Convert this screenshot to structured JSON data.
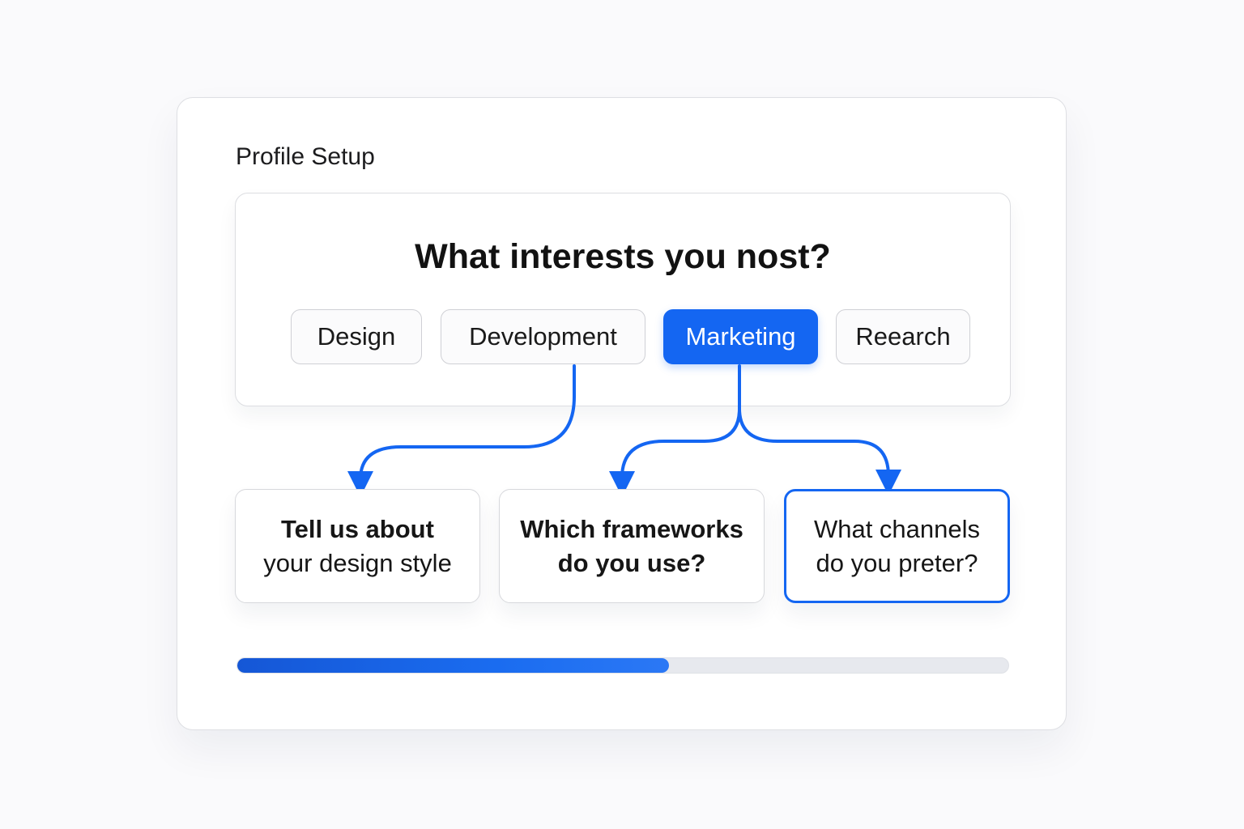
{
  "profile": {
    "title": "Profile Setup"
  },
  "question": {
    "title": "What interests you nost?",
    "options": [
      {
        "label": "Design",
        "selected": false
      },
      {
        "label": "Development",
        "selected": false
      },
      {
        "label": "Marketing",
        "selected": true
      },
      {
        "label": "Reearch",
        "selected": false
      }
    ]
  },
  "followups": [
    {
      "line1": "Tell us about",
      "line2": "your design style",
      "active": false
    },
    {
      "line1": "Which frameworks",
      "line2": "do you use?",
      "active": false
    },
    {
      "line1": "What channels",
      "line2": "do you preter?",
      "active": true
    }
  ],
  "progress": {
    "fraction": 0.56
  },
  "colors": {
    "accent": "#1466f2",
    "background": "#fafafc",
    "track": "#e7e9ee"
  }
}
